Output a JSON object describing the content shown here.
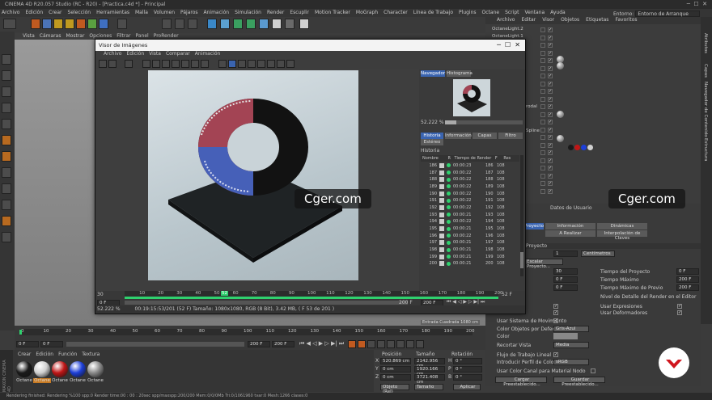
{
  "app": {
    "title": "CINEMA 4D R20.057 Studio (RC - R20) - [Practica.c4d *] - Principal"
  },
  "menu": [
    "Archivo",
    "Edición",
    "Crear",
    "Selección",
    "Herramientas",
    "Malla",
    "Volumen",
    "Pájaros",
    "Animación",
    "Simulación",
    "Render",
    "Escuplir",
    "Motion Tracker",
    "MoGraph",
    "Character",
    "Línea de Trabajo",
    "Plugins",
    "Octane",
    "Script",
    "Ventana",
    "Ayuda"
  ],
  "om_menu": [
    "Archivo",
    "Editar",
    "Visor",
    "Objetos",
    "Etiquetas",
    "Favoritos"
  ],
  "entorno_label": "Entorno:",
  "entorno_value": "Entorno de Arranque",
  "viewport_menu": [
    "Vista",
    "Cámaras",
    "Mostrar",
    "Opciones",
    "Filtrar",
    "Panel",
    "ProRender"
  ],
  "om_items": [
    "OctaneLight.2",
    "OctaneLight.1"
  ],
  "om_partial": [
    "rodal",
    "Spline"
  ],
  "viewer": {
    "title": "Visor de Imágenes",
    "menu": [
      "Archivo",
      "Edición",
      "Vista",
      "Comparar",
      "Animación"
    ],
    "nav_tabs": [
      "Navegador",
      "Histograma"
    ],
    "zoom": "52.222 %",
    "panel_tabs": [
      "Historia",
      "Información",
      "Capas",
      "Filtro",
      "Estéreo"
    ],
    "historia_label": "Historia",
    "cols": [
      "Nombre",
      "R",
      "Tiempo de Render",
      "F",
      "Res"
    ],
    "rows": [
      {
        "n": "186",
        "t": "00:00:23",
        "f": "186",
        "r": "108"
      },
      {
        "n": "187",
        "t": "00:00:22",
        "f": "187",
        "r": "108"
      },
      {
        "n": "188",
        "t": "00:00:22",
        "f": "188",
        "r": "108"
      },
      {
        "n": "189",
        "t": "00:00:22",
        "f": "189",
        "r": "108"
      },
      {
        "n": "190",
        "t": "00:00:22",
        "f": "190",
        "r": "108"
      },
      {
        "n": "191",
        "t": "00:00:22",
        "f": "191",
        "r": "108"
      },
      {
        "n": "192",
        "t": "00:00:22",
        "f": "192",
        "r": "108"
      },
      {
        "n": "193",
        "t": "00:00:21",
        "f": "193",
        "r": "108"
      },
      {
        "n": "194",
        "t": "00:00:22",
        "f": "194",
        "r": "108"
      },
      {
        "n": "195",
        "t": "00:00:21",
        "f": "195",
        "r": "108"
      },
      {
        "n": "196",
        "t": "00:00:22",
        "f": "196",
        "r": "108"
      },
      {
        "n": "197",
        "t": "00:00:21",
        "f": "197",
        "r": "108"
      },
      {
        "n": "198",
        "t": "00:00:21",
        "f": "198",
        "r": "108"
      },
      {
        "n": "199",
        "t": "00:00:21",
        "f": "199",
        "r": "108"
      },
      {
        "n": "200",
        "t": "00:00:21",
        "f": "200",
        "r": "108"
      }
    ],
    "tl_start": "30",
    "tl_marks": [
      "10",
      "20",
      "30",
      "40",
      "50",
      "60",
      "70",
      "80",
      "90",
      "100",
      "110",
      "120",
      "130",
      "140",
      "150",
      "160",
      "170",
      "180",
      "190",
      "200"
    ],
    "tl_cur": "52",
    "tl_end": "52 F",
    "tl_frame_l": "0 F",
    "tl_frame_m": "200 F",
    "tl_frame_r": "200 F",
    "status_zoom": "52.222 %",
    "status_info": "00:19:15:53/201 (52 F)     Tamaño: 1080x1080, RGB (8 Bit), 3.42 MB,  ( F 53 de 201 )"
  },
  "watermark": "Cger.com",
  "attr": {
    "tabs_row1": [
      "Proyecto",
      "Información",
      "Dinámicas"
    ],
    "tabs_row2": [
      "A Realizar",
      "Interpolación de Claves"
    ],
    "header": "Datos de Usuario",
    "section": "Proyecto",
    "escala_value": "1",
    "escala_unit": "Centímetros",
    "escalar_btn": "Escalar Proyecto...",
    "rows": [
      {
        "l": "Tiempo del Proyecto",
        "v": "0 F"
      },
      {
        "l": "Tiempo Máximo",
        "v": "200 F"
      },
      {
        "l": "Tiempo Máximo de Previo",
        "v": "200 F"
      }
    ],
    "left_vals": [
      "30",
      "0 F",
      "0 F"
    ],
    "nivel": "Nivel de Detalle del Render en el Editor",
    "usar_expr": "Usar Expresiones",
    "usar_def": "Usar Deformadores",
    "usar_mov": "Usar Sistema de Movimiento",
    "color_obj_label": "Color Objetos por Defecto",
    "color_obj_val": "Gris-Azul",
    "color_label": "Color",
    "recortar_label": "Recortar Vista",
    "recortar_val": "Media",
    "flujo_label": "Flujo de Trabajo Lineal",
    "perfil_label": "Introducir Perfil de Color",
    "perfil_val": "sRGB",
    "canal_label": "Usar Color Canal para Material Nodo",
    "btn_cargar": "Cargar Preestablecido...",
    "btn_guardar": "Guardar Preestablecido..."
  },
  "right_side_tabs": [
    "Atributos",
    "Capas",
    "Navegador de Contenido",
    "Estructura"
  ],
  "timeline": {
    "marks": [
      "0",
      "10",
      "20",
      "30",
      "40",
      "50",
      "60",
      "70",
      "80",
      "90",
      "100",
      "110",
      "120",
      "130",
      "140",
      "150",
      "160",
      "170",
      "180",
      "190",
      "200"
    ],
    "start": "0 F",
    "cur": "0 F",
    "end": "200 F",
    "end2": "200 F"
  },
  "materials": {
    "menu": [
      "Crear",
      "Edición",
      "Función",
      "Textura"
    ],
    "items": [
      {
        "label": "Octane",
        "color": "#1a1a1a"
      },
      {
        "label": "Octane",
        "color": "#d0d0d0"
      },
      {
        "label": "Octane",
        "color": "#c01616"
      },
      {
        "label": "Octane",
        "color": "#1d3fd8"
      },
      {
        "label": "Octane",
        "color": "#8a8a8a"
      }
    ]
  },
  "coords": {
    "headers": [
      "Posición",
      "Tamaño",
      "Rotación"
    ],
    "rows": [
      {
        "a": "X",
        "p": "520.869 cm",
        "s": "2142.956 cm",
        "r": "H",
        "rv": "0 °"
      },
      {
        "a": "Y",
        "p": "0 cm",
        "s": "1920.166 cm",
        "r": "P",
        "rv": "0 °"
      },
      {
        "a": "Z",
        "p": "0 cm",
        "s": "3721.408 cm",
        "r": "B",
        "rv": "0 °"
      }
    ],
    "mode": "Objeto (Rel)",
    "size_mode": "Tamaño",
    "apply": "Aplicar"
  },
  "status": "Rendering finished: Rendering %100 spp:0 Render time:00 : 00 : 20sec spp/maxspp:200/200 Mem:0/0/0Mb Tri:0/1061960 tvar:0 Mesh:1266 clases:0",
  "maxon": "MAXON CINEMA 4D",
  "viewer_vertical_dim": "Entrada Cuadrada 1080 cm"
}
